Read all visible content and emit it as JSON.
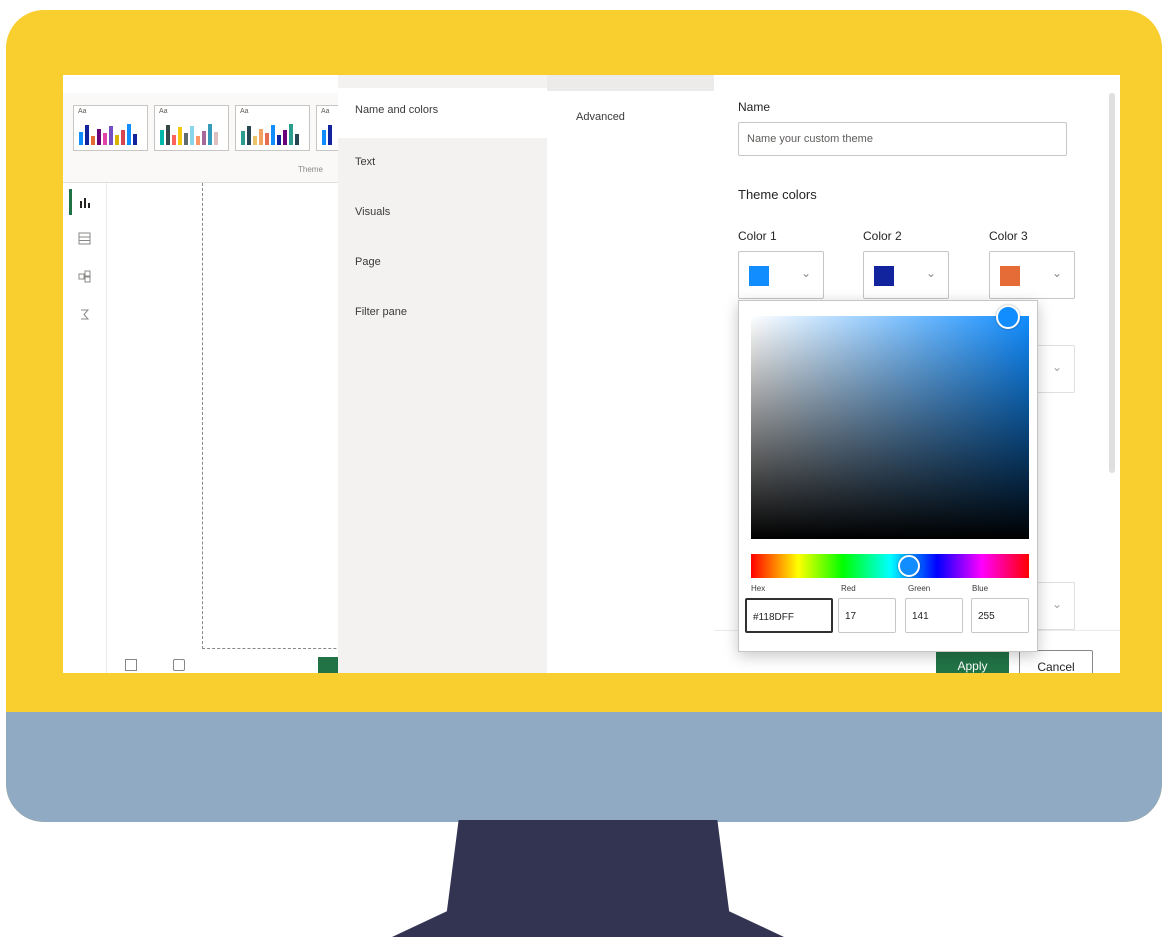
{
  "colors": {
    "bezel": "#f9cf2f",
    "chin": "#8faac2",
    "stand": "#323452",
    "apply_button": "#217346",
    "color_1": "#118dff",
    "color_2": "#12239e",
    "color_3": "#e66c37"
  },
  "report": {
    "themes_caption": "Theme",
    "theme_thumb_text": "Aa",
    "nav_icons": [
      "report-view-icon",
      "table-view-icon",
      "model-view-icon",
      "dax-query-icon"
    ]
  },
  "dialog": {
    "nav_items": [
      "Name and colors",
      "Text",
      "Visuals",
      "Page",
      "Filter pane"
    ],
    "tab_label": "Advanced",
    "name_label": "Name",
    "name_placeholder": "Name your custom theme",
    "theme_colors_label": "Theme colors",
    "color_labels": [
      "Color 1",
      "Color 2",
      "Color 3"
    ],
    "apply_label": "Apply",
    "cancel_label": "Cancel"
  },
  "picker": {
    "hex_label": "Hex",
    "red_label": "Red",
    "green_label": "Green",
    "blue_label": "Blue",
    "hex_value": "#118DFF",
    "red_value": "17",
    "green_value": "141",
    "blue_value": "255"
  }
}
